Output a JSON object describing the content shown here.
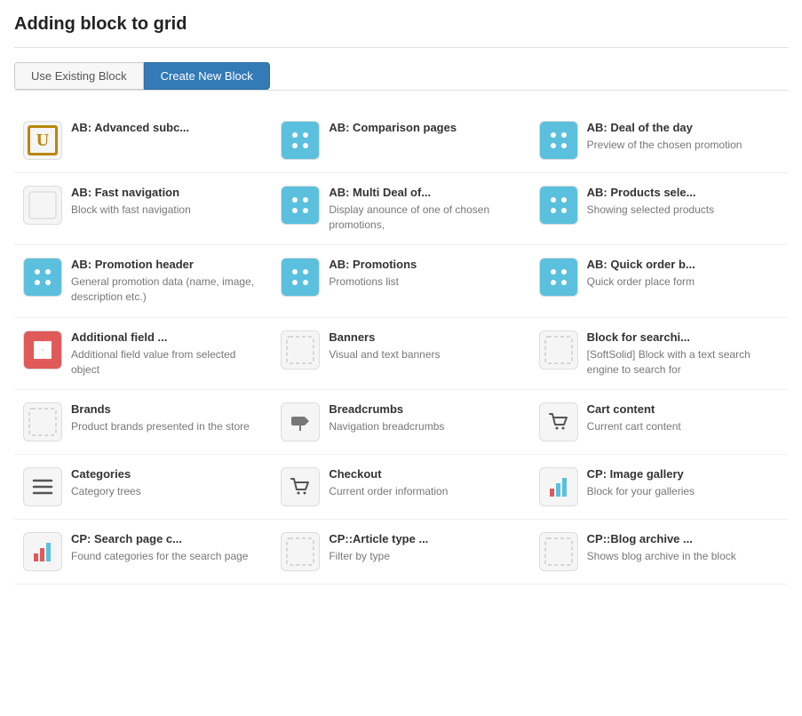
{
  "page": {
    "title": "Adding block to grid"
  },
  "tabs": [
    {
      "id": "use-existing",
      "label": "Use Existing Block",
      "active": false
    },
    {
      "id": "create-new",
      "label": "Create New Block",
      "active": true
    }
  ],
  "blocks": [
    {
      "id": "ab-advanced",
      "name": "AB: Advanced subc...",
      "desc": "",
      "icon_type": "u-icon",
      "icon_bg": "white-bg"
    },
    {
      "id": "ab-comparison",
      "name": "AB: Comparison pages",
      "desc": "",
      "icon_type": "dots",
      "icon_bg": "blue-bg"
    },
    {
      "id": "ab-deal",
      "name": "AB: Deal of the day",
      "desc": "Preview of the chosen promotion",
      "icon_type": "dots",
      "icon_bg": "blue-bg"
    },
    {
      "id": "ab-fast",
      "name": "AB: Fast navigation",
      "desc": "Block with fast navigation",
      "icon_type": "empty",
      "icon_bg": "white-bg"
    },
    {
      "id": "ab-multi-deal",
      "name": "AB: Multi Deal of...",
      "desc": "Display anounce of one of chosen promotions,",
      "icon_type": "dots",
      "icon_bg": "blue-bg"
    },
    {
      "id": "ab-products",
      "name": "AB: Products sele...",
      "desc": "Showing selected products",
      "icon_type": "dots",
      "icon_bg": "blue-bg"
    },
    {
      "id": "ab-promotion-header",
      "name": "AB: Promotion header",
      "desc": "General promotion data (name, image, description etc.)",
      "icon_type": "dots",
      "icon_bg": "blue-bg"
    },
    {
      "id": "ab-promotions",
      "name": "AB: Promotions",
      "desc": "Promotions list",
      "icon_type": "dots",
      "icon_bg": "blue-bg"
    },
    {
      "id": "ab-quick-order",
      "name": "AB: Quick order b...",
      "desc": "Quick order place form",
      "icon_type": "dots",
      "icon_bg": "blue-bg"
    },
    {
      "id": "additional-field",
      "name": "Additional field ...",
      "desc": "Additional field value from selected object",
      "icon_type": "puzzle",
      "icon_bg": "red-bg"
    },
    {
      "id": "banners",
      "name": "Banners",
      "desc": "Visual and text banners",
      "icon_type": "dashed",
      "icon_bg": "white-bg"
    },
    {
      "id": "block-search",
      "name": "Block for searchi...",
      "desc": "[SoftSolid] Block with a text search engine to search for",
      "icon_type": "dashed",
      "icon_bg": "white-bg"
    },
    {
      "id": "brands",
      "name": "Brands",
      "desc": "Product brands presented in the store",
      "icon_type": "dashed",
      "icon_bg": "white-bg"
    },
    {
      "id": "breadcrumbs",
      "name": "Breadcrumbs",
      "desc": "Navigation breadcrumbs",
      "icon_type": "sign",
      "icon_bg": "white-bg"
    },
    {
      "id": "cart-content",
      "name": "Cart content",
      "desc": "Current cart content",
      "icon_type": "cart",
      "icon_bg": "white-bg"
    },
    {
      "id": "categories",
      "name": "Categories",
      "desc": "Category trees",
      "icon_type": "lines",
      "icon_bg": "white-bg"
    },
    {
      "id": "checkout",
      "name": "Checkout",
      "desc": "Current order information",
      "icon_type": "cart",
      "icon_bg": "white-bg"
    },
    {
      "id": "cp-image-gallery",
      "name": "CP: Image gallery",
      "desc": "Block for your galleries",
      "icon_type": "bar-chart",
      "icon_bg": "white-bg"
    },
    {
      "id": "cp-search-page",
      "name": "CP: Search page c...",
      "desc": "Found categories for the search page",
      "icon_type": "bar-chart-red",
      "icon_bg": "white-bg"
    },
    {
      "id": "cp-article-type",
      "name": "CP::Article type ...",
      "desc": "Filter by type",
      "icon_type": "dashed",
      "icon_bg": "white-bg"
    },
    {
      "id": "cp-blog-archive",
      "name": "CP::Blog archive ...",
      "desc": "Shows blog archive in the block",
      "icon_type": "dashed",
      "icon_bg": "white-bg"
    }
  ]
}
